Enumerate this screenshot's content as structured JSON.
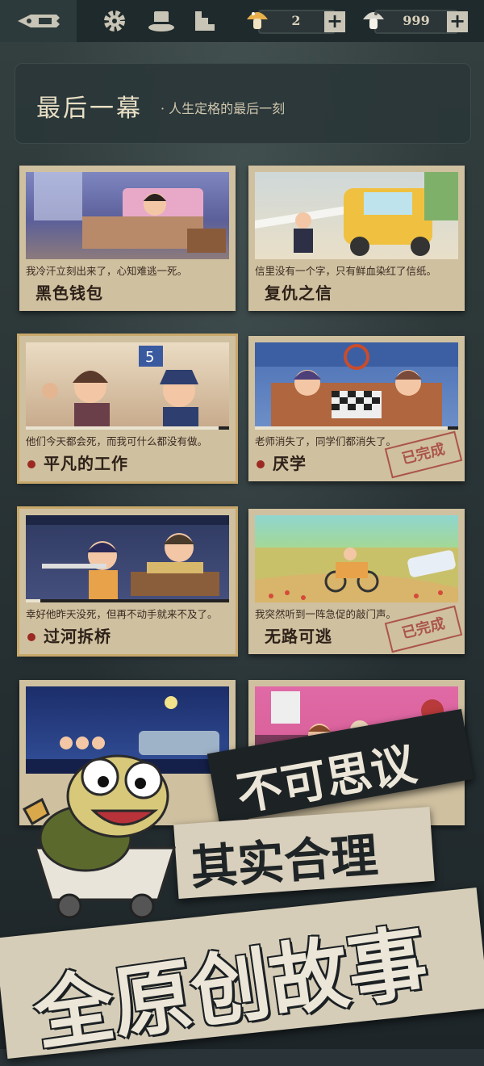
{
  "currency": {
    "ticket_value": "2",
    "coin_value": "999"
  },
  "header": {
    "title": "最后一幕",
    "subtitle": "· 人生定格的最后一刻"
  },
  "cards": [
    {
      "caption": "我冷汗立刻出来了，心知难逃一死。",
      "title": "黑色钱包",
      "progress": null,
      "completed": false,
      "selected": false
    },
    {
      "caption": "信里没有一个字，只有鲜血染红了信纸。",
      "title": "复仇之信",
      "progress": null,
      "completed": false,
      "selected": false
    },
    {
      "caption": "他们今天都会死，而我可什么都没有做。",
      "title": "平凡的工作",
      "progress": 0.95,
      "completed": false,
      "selected": true
    },
    {
      "caption": "老师消失了，同学们都消失了。",
      "title": "厌学",
      "progress": 0.95,
      "completed": true,
      "selected": false
    },
    {
      "caption": "幸好他昨天没死，但再不动手就来不及了。",
      "title": "过河拆桥",
      "progress": 0.07,
      "completed": false,
      "selected": true
    },
    {
      "caption": "我突然听到一阵急促的敲门声。",
      "title": "无路可逃",
      "progress": null,
      "completed": true,
      "selected": false
    },
    {
      "caption": "",
      "title": "",
      "progress": null,
      "completed": false,
      "selected": false
    },
    {
      "caption": "",
      "title": "",
      "progress": null,
      "completed": false,
      "selected": false
    }
  ],
  "completed_stamp": "已完成",
  "promo": {
    "line1": "不可思议",
    "line2": "其实合理",
    "line3": "全原创故事"
  },
  "colors": {
    "accent": "#c8a86a",
    "stamp": "#a5433a",
    "card": "#cfc0a0"
  },
  "icons": [
    "pen-logo-icon",
    "gear-icon",
    "top-hat-icon",
    "stairs-icon",
    "mushroom-ticket-icon",
    "mushroom-coin-icon",
    "plus-icon"
  ]
}
